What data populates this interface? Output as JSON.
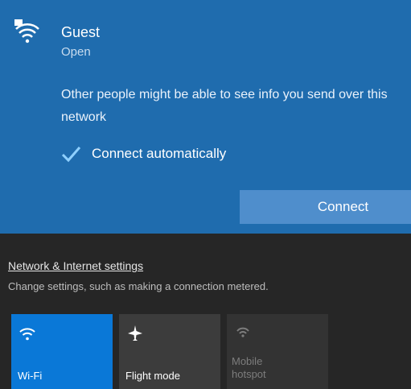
{
  "network": {
    "ssid": "Guest",
    "security_status": "Open",
    "warning_text": "Other people might be able to see info you send over this network",
    "auto_connect_label": "Connect automatically",
    "auto_connect_checked": true,
    "connect_button": "Connect"
  },
  "footer": {
    "settings_link": "Network & Internet settings",
    "settings_description": "Change settings, such as making a connection metered."
  },
  "quick_actions": [
    {
      "label": "Wi-Fi",
      "icon": "wifi-icon",
      "active": true
    },
    {
      "label": "Flight mode",
      "icon": "airplane-icon",
      "active": false
    },
    {
      "label": "Mobile hotspot",
      "icon": "hotspot-icon",
      "active": false,
      "disabled": true
    }
  ],
  "colors": {
    "card_background": "#1f6cae",
    "active_tile": "#0a78d7",
    "connect_button": "#4f8ecc",
    "flyout_background": "#262626"
  }
}
